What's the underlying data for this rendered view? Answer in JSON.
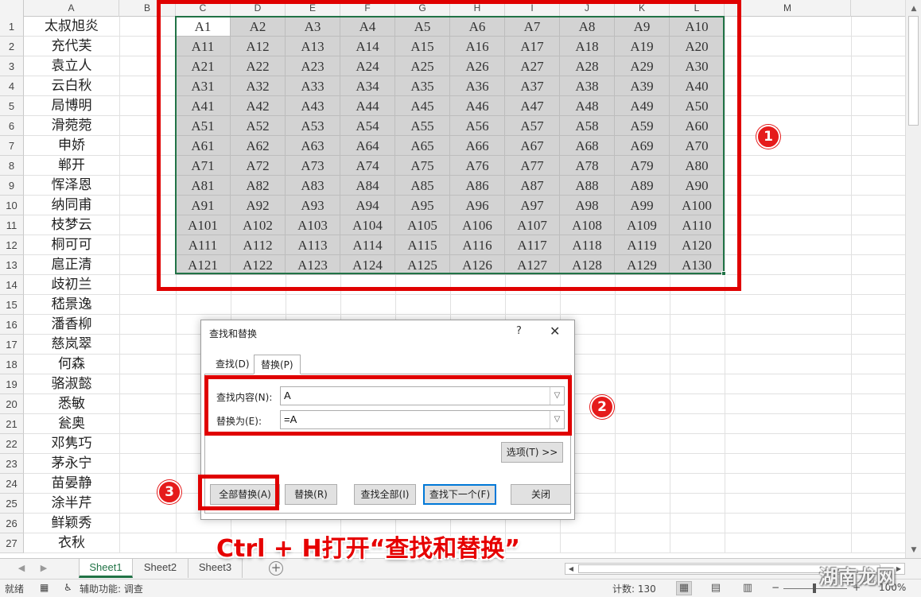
{
  "columns": [
    "A",
    "B",
    "C",
    "D",
    "E",
    "F",
    "G",
    "H",
    "I",
    "J",
    "K",
    "L",
    "M"
  ],
  "rows": [
    "1",
    "2",
    "3",
    "4",
    "5",
    "6",
    "7",
    "8",
    "9",
    "10",
    "11",
    "12",
    "13",
    "14",
    "15",
    "16",
    "17",
    "18",
    "19",
    "20",
    "21",
    "22",
    "23",
    "24",
    "25",
    "26",
    "27"
  ],
  "names": [
    "太叔旭炎",
    "充代芙",
    "袁立人",
    "云白秋",
    "局博明",
    "滑菀菀",
    "申娇",
    "郸开",
    "恽泽恩",
    "纳同甫",
    "枝梦云",
    "桐可可",
    "扈正清",
    "歧初兰",
    "嵇景逸",
    "潘香柳",
    "慈岚翠",
    "何森",
    "骆淑懿",
    "悉敏",
    "瓮奥",
    "邓隽巧",
    "茅永宁",
    "苗晏静",
    "涂半芹",
    "鲜颖秀",
    "衣秋"
  ],
  "grid": [
    [
      "A1",
      "A2",
      "A3",
      "A4",
      "A5",
      "A6",
      "A7",
      "A8",
      "A9",
      "A10"
    ],
    [
      "A11",
      "A12",
      "A13",
      "A14",
      "A15",
      "A16",
      "A17",
      "A18",
      "A19",
      "A20"
    ],
    [
      "A21",
      "A22",
      "A23",
      "A24",
      "A25",
      "A26",
      "A27",
      "A28",
      "A29",
      "A30"
    ],
    [
      "A31",
      "A32",
      "A33",
      "A34",
      "A35",
      "A36",
      "A37",
      "A38",
      "A39",
      "A40"
    ],
    [
      "A41",
      "A42",
      "A43",
      "A44",
      "A45",
      "A46",
      "A47",
      "A48",
      "A49",
      "A50"
    ],
    [
      "A51",
      "A52",
      "A53",
      "A54",
      "A55",
      "A56",
      "A57",
      "A58",
      "A59",
      "A60"
    ],
    [
      "A61",
      "A62",
      "A63",
      "A64",
      "A65",
      "A66",
      "A67",
      "A68",
      "A69",
      "A70"
    ],
    [
      "A71",
      "A72",
      "A73",
      "A74",
      "A75",
      "A76",
      "A77",
      "A78",
      "A79",
      "A80"
    ],
    [
      "A81",
      "A82",
      "A83",
      "A84",
      "A85",
      "A86",
      "A87",
      "A88",
      "A89",
      "A90"
    ],
    [
      "A91",
      "A92",
      "A93",
      "A94",
      "A95",
      "A96",
      "A97",
      "A98",
      "A99",
      "A100"
    ],
    [
      "A101",
      "A102",
      "A103",
      "A104",
      "A105",
      "A106",
      "A107",
      "A108",
      "A109",
      "A110"
    ],
    [
      "A111",
      "A112",
      "A113",
      "A114",
      "A115",
      "A116",
      "A117",
      "A118",
      "A119",
      "A120"
    ],
    [
      "A121",
      "A122",
      "A123",
      "A124",
      "A125",
      "A126",
      "A127",
      "A128",
      "A129",
      "A130"
    ]
  ],
  "badges": [
    "1",
    "2",
    "3"
  ],
  "dialog": {
    "title": "查找和替换",
    "help": "?",
    "close": "✕",
    "tab_find": "查找(D)",
    "tab_replace": "替换(P)",
    "find_label": "查找内容(N):",
    "find_value": "A",
    "replace_label": "替换为(E):",
    "replace_value": "=A",
    "options_btn": "选项(T) >>",
    "replace_all_btn": "全部替换(A)",
    "replace_btn": "替换(R)",
    "find_all_btn": "查找全部(I)",
    "find_next_btn": "查找下一个(F)",
    "close_btn": "关闭"
  },
  "sheet_tabs": [
    "Sheet1",
    "Sheet2",
    "Sheet3"
  ],
  "add_sheet": "+",
  "status": {
    "ready": "就绪",
    "accessibility": "辅助功能: 调查",
    "count": "计数: 130",
    "zoom": "100%"
  },
  "caption": "Ctrl + H打开“查找和替换”",
  "watermark": "湖南龙网",
  "colors": {
    "accent": "#217346",
    "highlight": "#e00000",
    "selection_fill": "#d3d3d3"
  }
}
